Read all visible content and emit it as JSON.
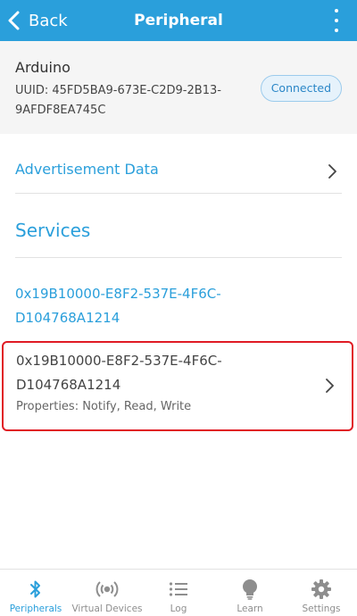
{
  "colors": {
    "accent": "#2a9fdb",
    "highlight_border": "#e01b24",
    "inactive": "#8e8e8e"
  },
  "navbar": {
    "back_label": "Back",
    "title": "Peripheral",
    "back_icon": "chevron-left-icon",
    "more_icon": "more-vertical-icon"
  },
  "device": {
    "name": "Arduino",
    "uuid": "UUID: 45FD5BA9-673E-C2D9-2B13-9AFDF8EA745C",
    "status": "Connected"
  },
  "advertisement": {
    "label": "Advertisement Data"
  },
  "services": {
    "header": "Services",
    "items": [
      {
        "uuid": "0x19B10000-E8F2-537E-4F6C-D104768A1214"
      }
    ]
  },
  "characteristic": {
    "uuid": "0x19B10000-E8F2-537E-4F6C-D104768A1214",
    "properties": "Properties: Notify, Read, Write"
  },
  "tabs": [
    {
      "label": "Peripherals",
      "icon": "bluetooth-icon",
      "active": true
    },
    {
      "label": "Virtual Devices",
      "icon": "broadcast-icon",
      "active": false
    },
    {
      "label": "Log",
      "icon": "list-icon",
      "active": false
    },
    {
      "label": "Learn",
      "icon": "lightbulb-icon",
      "active": false
    },
    {
      "label": "Settings",
      "icon": "gear-icon",
      "active": false
    }
  ]
}
